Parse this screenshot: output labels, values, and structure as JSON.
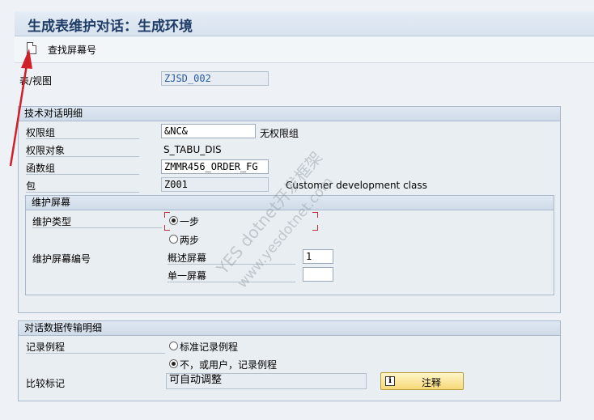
{
  "title": "生成表维护对话：生成环境",
  "toolbar": {
    "find_screen_label": "查找屏幕号"
  },
  "table_view": {
    "label": "表/视图",
    "value": "ZJSD_002"
  },
  "tech_details": {
    "header": "技术对话明细",
    "auth_group": {
      "label": "权限组",
      "value": "&NC&",
      "desc": "无权限组"
    },
    "auth_object": {
      "label": "权限对象",
      "value": "S_TABU_DIS"
    },
    "function_group": {
      "label": "函数组",
      "value": "ZMMR456_ORDER_FG"
    },
    "package": {
      "label": "包",
      "value": "Z001",
      "desc": "Customer development class"
    }
  },
  "maint_screens": {
    "header": "维护屏幕",
    "type_label": "维护类型",
    "one_step": "一步",
    "two_step": "两步",
    "selected": "一步",
    "screen_no_label": "维护屏幕编号",
    "overview_label": "概述屏幕",
    "overview_value": "1",
    "single_label": "单一屏幕",
    "single_value": ""
  },
  "transport": {
    "header": "对话数据传输明细",
    "recording_label": "记录例程",
    "standard_option": "标准记录例程",
    "no_or_user_option": "不，或用户，记录例程",
    "selected": "不，或用户，记录例程",
    "compare_label": "比较标记",
    "compare_value": "可自动调整",
    "note_button": "注释"
  },
  "watermark": {
    "line1": "YES dotnet开发框架",
    "line2": "www.yesdotnet.com"
  },
  "colors": {
    "annotation_arrow": "#d0202a",
    "title_text": "#1f3d66",
    "button_fill": "#f6d978"
  }
}
